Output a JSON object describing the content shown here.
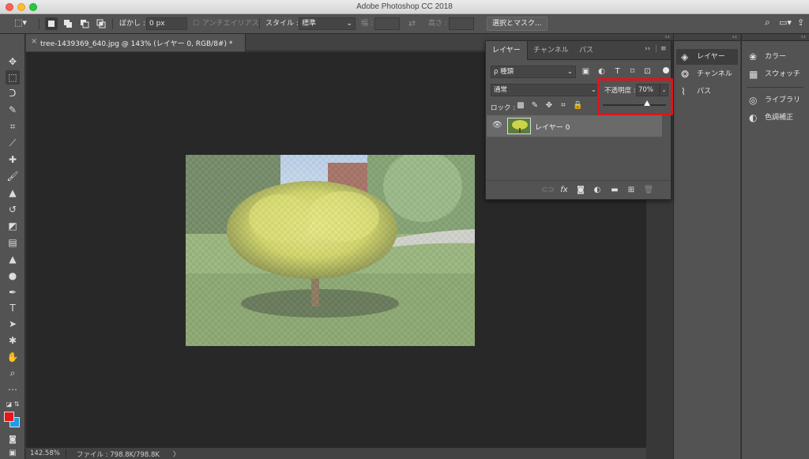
{
  "window": {
    "title": "Adobe Photoshop CC 2018"
  },
  "options_bar": {
    "feather_label": "ぼかし :",
    "feather_value": "0 px",
    "antialias_label": "アンチエイリアス",
    "style_label": "スタイル :",
    "style_value": "標準",
    "width_label": "幅 :",
    "height_label": "高さ :",
    "select_mask_button": "選択とマスク..."
  },
  "document": {
    "tab_title": "tree-1439369_640.jpg @ 143% (レイヤー 0, RGB/8#) *",
    "close_glyph": "×"
  },
  "status_bar": {
    "zoom": "142.58%",
    "file_info": "ファイル : 798.8K/798.8K",
    "arrow": "〉"
  },
  "layers_panel": {
    "tabs": [
      "レイヤー",
      "チャンネル",
      "パス"
    ],
    "active_tab": 0,
    "filter_value": "ρ 種類",
    "blend_mode": "通常",
    "opacity_label": "不透明度 :",
    "opacity_value": "70%",
    "opacity_level": 0.7,
    "lock_label": "ロック :",
    "layers": [
      {
        "name": "レイヤー 0",
        "visible": true,
        "selected": true
      }
    ]
  },
  "dock_mid": {
    "items": [
      {
        "label": "レイヤー",
        "icon": "layers-icon",
        "active": true
      },
      {
        "label": "チャンネル",
        "icon": "channels-icon",
        "active": false
      },
      {
        "label": "パス",
        "icon": "paths-icon",
        "active": false
      }
    ]
  },
  "dock_right": {
    "items": [
      {
        "label": "カラー",
        "icon": "color-icon"
      },
      {
        "label": "スウォッチ",
        "icon": "swatches-icon"
      },
      {
        "label": "ライブラリ",
        "icon": "libraries-icon"
      },
      {
        "label": "色調補正",
        "icon": "adjustments-icon"
      }
    ]
  },
  "colors": {
    "foreground": "#e8161b",
    "background": "#1f9be8",
    "highlight": "#e0151a"
  }
}
